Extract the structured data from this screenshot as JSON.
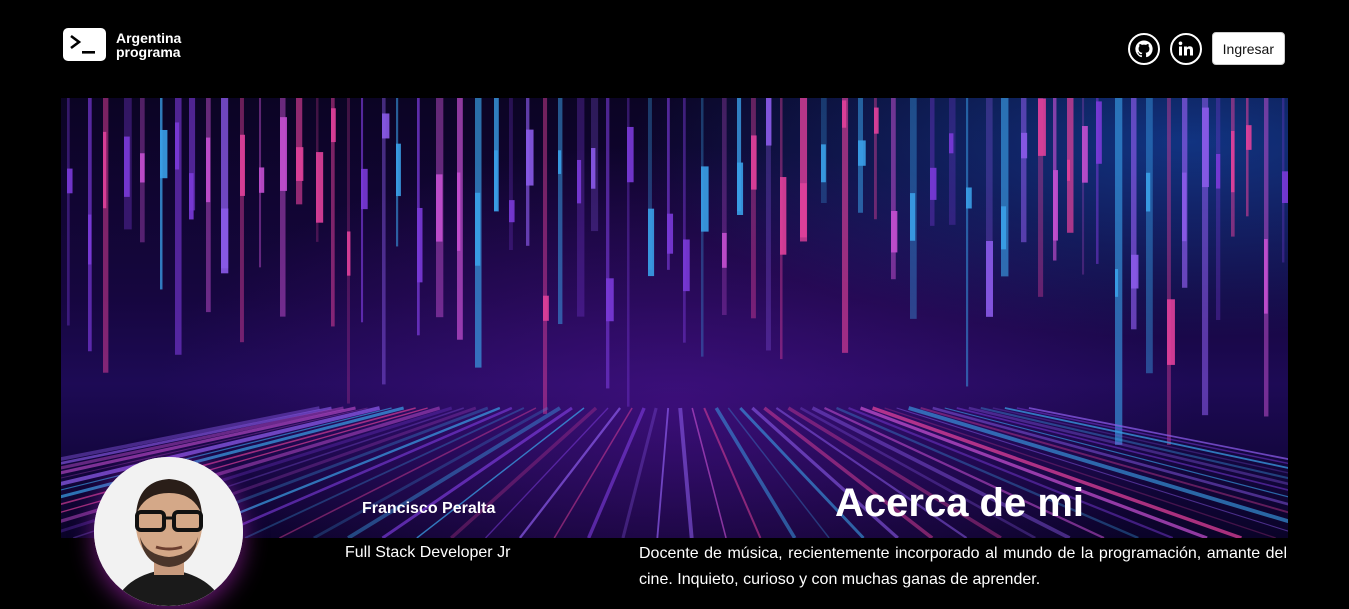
{
  "brand": {
    "name_line1": "Argentina",
    "name_line2": "programa",
    "logo_icon": "terminal-prompt-icon"
  },
  "nav": {
    "github_icon": "github-icon",
    "linkedin_icon": "linkedin-icon",
    "login_label": "Ingresar"
  },
  "profile": {
    "name": "Francisco Peralta",
    "role": "Full Stack Developer Jr"
  },
  "about": {
    "title": "Acerca de mi",
    "text": "Docente de música, recientemente incorporado al mundo de la programación, amante del cine. Inquieto, curioso y con muchas ganas de aprender."
  },
  "colors": {
    "background": "#000000",
    "banner_deep": "#16063f",
    "accent_pink": "#e0409a",
    "accent_blue": "#3aa0e8",
    "accent_purple": "#7a3ad8"
  }
}
